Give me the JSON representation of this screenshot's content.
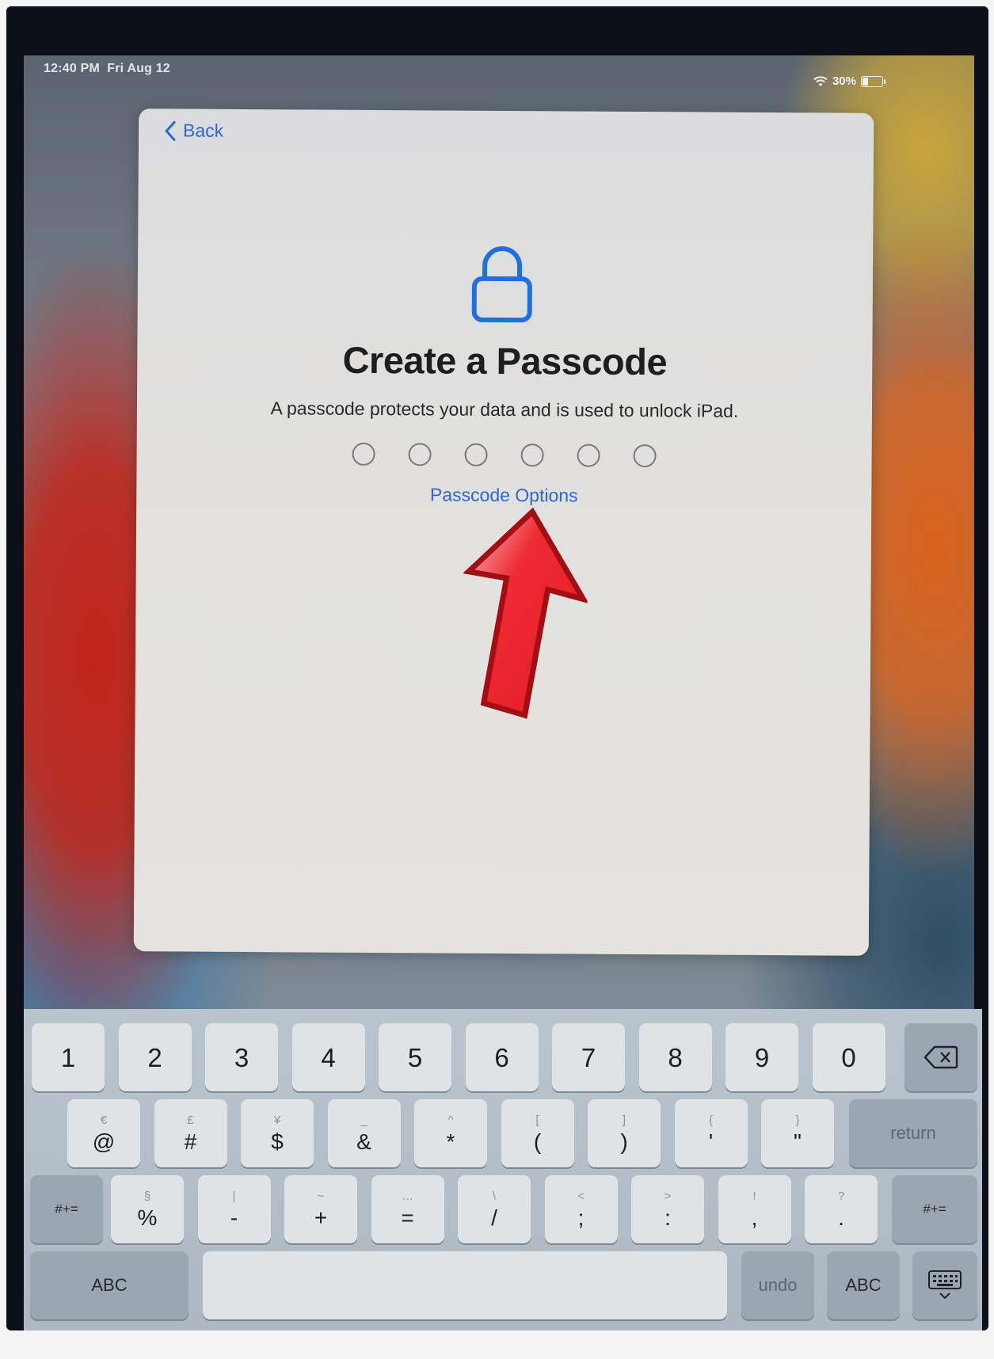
{
  "status_bar": {
    "time": "12:40 PM",
    "date": "Fri Aug 12",
    "battery": "30%",
    "battery_level": 0.3
  },
  "dialog": {
    "back_label": "Back",
    "title": "Create a Passcode",
    "subtitle": "A passcode protects your data and is used to unlock iPad.",
    "passcode_length": 6,
    "options_label": "Passcode Options",
    "accent_color": "#2b66d6",
    "annotation_arrow_color": "#e21b25"
  },
  "keyboard": {
    "row1": [
      "1",
      "2",
      "3",
      "4",
      "5",
      "6",
      "7",
      "8",
      "9",
      "0"
    ],
    "row2": [
      {
        "sub": "€",
        "main": "@"
      },
      {
        "sub": "£",
        "main": "#"
      },
      {
        "sub": "¥",
        "main": "$"
      },
      {
        "sub": "_",
        "main": "&"
      },
      {
        "sub": "^",
        "main": "*"
      },
      {
        "sub": "[",
        "main": "("
      },
      {
        "sub": "]",
        "main": ")"
      },
      {
        "sub": "{",
        "main": "'"
      },
      {
        "sub": "}",
        "main": "\""
      }
    ],
    "return_label": "return",
    "symbols_label": "#+=",
    "row3": [
      {
        "sub": "§",
        "main": "%"
      },
      {
        "sub": "|",
        "main": "-"
      },
      {
        "sub": "~",
        "main": "+"
      },
      {
        "sub": "…",
        "main": "="
      },
      {
        "sub": "\\",
        "main": "/"
      },
      {
        "sub": "<",
        "main": ";"
      },
      {
        "sub": ">",
        "main": ":"
      },
      {
        "sub": "!",
        "main": ","
      },
      {
        "sub": "?",
        "main": "."
      }
    ],
    "abc_label": "ABC",
    "undo_label": "undo",
    "delete_icon": "backspace-icon",
    "dismiss_icon": "keyboard-dismiss-icon"
  }
}
